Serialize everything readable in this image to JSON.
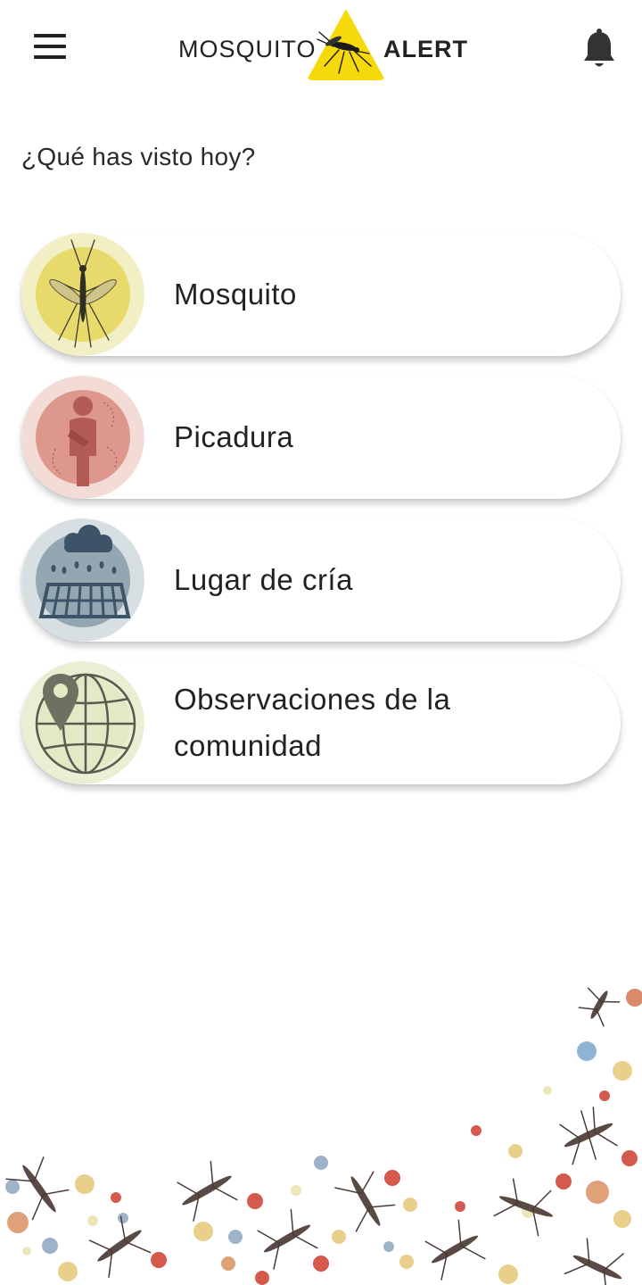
{
  "header": {
    "logo_left": "MOSQUITO",
    "logo_right": "ALERT",
    "menu_icon": "hamburger-menu-icon",
    "notification_icon": "bell-icon"
  },
  "prompt": "¿Qué has visto hoy?",
  "options": [
    {
      "label": "Mosquito",
      "icon": "mosquito-icon",
      "color": "#e8da6a"
    },
    {
      "label": "Picadura",
      "icon": "bite-person-icon",
      "color": "#dd978c"
    },
    {
      "label": "Lugar de cría",
      "icon": "breeding-site-icon",
      "color": "#93a6b2"
    },
    {
      "label": "Observaciones de la comunidad",
      "icon": "globe-location-icon",
      "color": "#e1e9c5"
    }
  ],
  "colors": {
    "logo_yellow": "#f5d90a",
    "text": "#222222"
  }
}
